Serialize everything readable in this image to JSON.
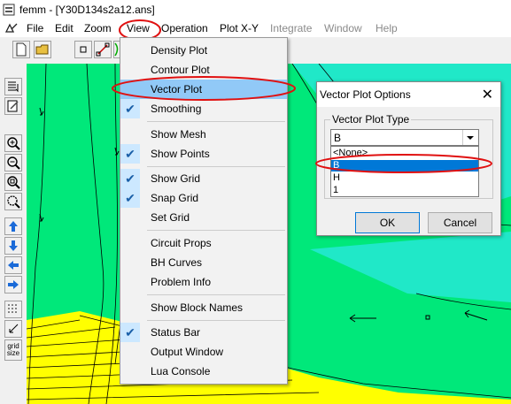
{
  "window": {
    "title": "femm - [Y30D134s2a12.ans]"
  },
  "menubar": {
    "items": [
      "File",
      "Edit",
      "Zoom",
      "View",
      "Operation",
      "Plot X-Y",
      "Integrate",
      "Window",
      "Help"
    ],
    "disabled": [
      "Integrate",
      "Window",
      "Help"
    ]
  },
  "view_menu": {
    "items": [
      {
        "label": "Density Plot",
        "checked": false
      },
      {
        "label": "Contour Plot",
        "checked": false
      },
      {
        "label": "Vector Plot",
        "checked": false,
        "highlighted": true
      },
      {
        "label": "Smoothing",
        "checked": true
      },
      {
        "label": "Show Mesh",
        "checked": false
      },
      {
        "label": "Show Points",
        "checked": true
      },
      {
        "label": "Show Grid",
        "checked": true
      },
      {
        "label": "Snap Grid",
        "checked": true
      },
      {
        "label": "Set Grid",
        "checked": false
      },
      {
        "label": "Circuit Props",
        "checked": false
      },
      {
        "label": "BH Curves",
        "checked": false
      },
      {
        "label": "Problem Info",
        "checked": false
      },
      {
        "label": "Show Block Names",
        "checked": false
      },
      {
        "label": "Status Bar",
        "checked": true
      },
      {
        "label": "Output Window",
        "checked": false
      },
      {
        "label": "Lua Console",
        "checked": false
      }
    ],
    "check_mark": "✔"
  },
  "dialog": {
    "title": "Vector Plot Options",
    "close": "✕",
    "group_label": "Vector Plot Type",
    "combo_value": "B",
    "options": [
      "<None>",
      "B",
      "H",
      "1"
    ],
    "selected_option": "B",
    "ok_label": "OK",
    "cancel_label": "Cancel"
  },
  "left_toolbar": {
    "grid_size_label": "grid size"
  },
  "colors": {
    "field_green": "#00e87a",
    "field_cyan": "#20e8c8",
    "field_yellow": "#ffff00",
    "annotation_red": "#e01010",
    "highlight": "#91c9f7",
    "selection": "#0078d7"
  }
}
